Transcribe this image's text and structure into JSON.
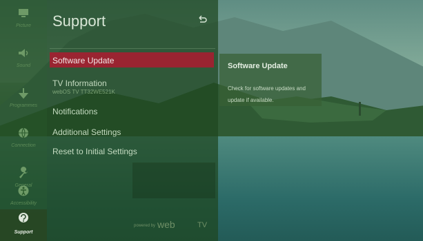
{
  "rail": [
    {
      "label": "Picture",
      "icon": "picture-icon",
      "active": false
    },
    {
      "label": "Sound",
      "icon": "sound-icon",
      "active": false
    },
    {
      "label": "Programmes",
      "icon": "antenna-icon",
      "active": false
    },
    {
      "label": "Connection",
      "icon": "globe-icon",
      "active": false
    },
    {
      "label": "General",
      "icon": "wrench-icon",
      "active": false
    },
    {
      "label": "Accessibility",
      "icon": "accessibility-icon",
      "active": false
    },
    {
      "label": "Support",
      "icon": "support-icon",
      "active": true
    }
  ],
  "menu": {
    "title": "Support",
    "items": [
      {
        "label": "Software Update",
        "selected": true
      },
      {
        "label": "TV Information",
        "sub": "webOS TV TT32WE521K"
      },
      {
        "label": "Notifications"
      },
      {
        "label": "Additional Settings"
      },
      {
        "label": "Reset to Initial Settings"
      }
    ]
  },
  "footer": {
    "powered": "powered by",
    "brand": "web",
    "tv": "TV"
  },
  "info": {
    "title": "Software Update",
    "description": "Check for software updates and update if available."
  },
  "colors": {
    "accent": "#9a2431",
    "panel": "#2d6a33",
    "text": "#c5dbc1"
  }
}
